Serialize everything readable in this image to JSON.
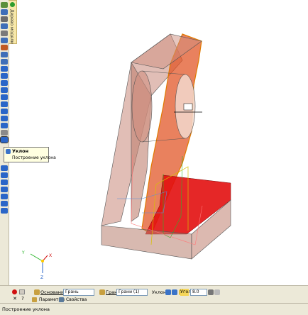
{
  "tree_tab": {
    "label": "Дерево модели"
  },
  "tooltip": {
    "title": "Уклон",
    "description": "Построение уклона"
  },
  "params": {
    "base_label": "Основание",
    "base_value": "Грань",
    "faces_label": "Грани",
    "faces_value": "Грани (1)",
    "slope_label": "Уклон",
    "angle_label": "Угол",
    "angle_value": "8.0"
  },
  "tabs": {
    "params": "Параметры",
    "properties": "Свойства"
  },
  "axes": {
    "x": "X",
    "y": "Y",
    "z": "Z"
  },
  "status": {
    "text": "Построение уклона"
  },
  "colors": {
    "toolbar_bg": "#ece9d8",
    "part_body": "#c8887a",
    "selected_face": "#e05020",
    "red_face": "#e21010",
    "tooltip_bg": "#ffffe1"
  }
}
